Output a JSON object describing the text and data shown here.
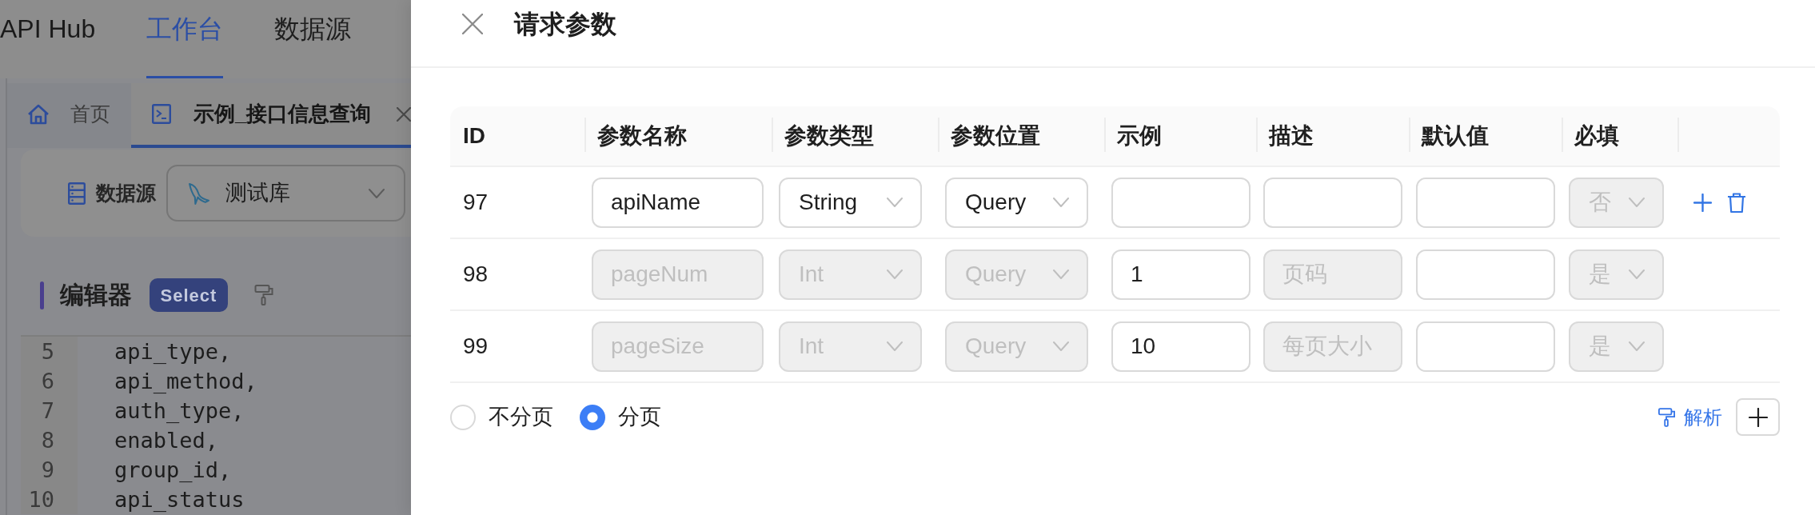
{
  "top_nav": {
    "brand": "API Hub",
    "items": [
      {
        "label": "工作台",
        "selected": true
      },
      {
        "label": "数据源",
        "selected": false
      }
    ]
  },
  "tabs": [
    {
      "kind": "home",
      "label": "首页",
      "selected": false,
      "closable": false
    },
    {
      "kind": "editor",
      "label": "示例_接口信息查询",
      "selected": true,
      "closable": true
    }
  ],
  "datasource": {
    "label": "数据源",
    "value": "测试库"
  },
  "editor": {
    "title": "编辑器",
    "statement_type": "Select",
    "lines": [
      {
        "number": "5",
        "code": "api_type,"
      },
      {
        "number": "6",
        "code": "api_method,"
      },
      {
        "number": "7",
        "code": "auth_type,"
      },
      {
        "number": "8",
        "code": "enabled,"
      },
      {
        "number": "9",
        "code": "group_id,"
      },
      {
        "number": "10",
        "code": "api_status"
      }
    ]
  },
  "drawer": {
    "title": "请求参数",
    "table": {
      "columns": [
        "ID",
        "参数名称",
        "参数类型",
        "参数位置",
        "示例",
        "描述",
        "默认值",
        "必填"
      ],
      "rows": [
        {
          "cells": [
            {
              "kind": "text",
              "value": "97"
            },
            {
              "kind": "input",
              "value": "apiName",
              "disabled": false
            },
            {
              "kind": "select",
              "value": "String",
              "disabled": false
            },
            {
              "kind": "select",
              "value": "Query",
              "disabled": false
            },
            {
              "kind": "input",
              "disabled": false
            },
            {
              "kind": "input",
              "disabled": false
            },
            {
              "kind": "input",
              "disabled": false
            },
            {
              "kind": "select",
              "value": "否",
              "disabled": true
            }
          ],
          "actions": true
        },
        {
          "cells": [
            {
              "kind": "text",
              "value": "98"
            },
            {
              "kind": "input",
              "value": "pageNum",
              "disabled": true
            },
            {
              "kind": "select",
              "value": "Int",
              "disabled": true
            },
            {
              "kind": "select",
              "value": "Query",
              "disabled": true
            },
            {
              "kind": "input",
              "value": "1",
              "disabled": false
            },
            {
              "kind": "input",
              "value": "页码",
              "disabled": true
            },
            {
              "kind": "input",
              "disabled": false
            },
            {
              "kind": "select",
              "value": "是",
              "disabled": true
            }
          ],
          "actions": false
        },
        {
          "cells": [
            {
              "kind": "text",
              "value": "99"
            },
            {
              "kind": "input",
              "value": "pageSize",
              "disabled": true
            },
            {
              "kind": "select",
              "value": "Int",
              "disabled": true
            },
            {
              "kind": "select",
              "value": "Query",
              "disabled": true
            },
            {
              "kind": "input",
              "value": "10",
              "disabled": false
            },
            {
              "kind": "input",
              "value": "每页大小",
              "disabled": true
            },
            {
              "kind": "input",
              "disabled": false
            },
            {
              "kind": "select",
              "value": "是",
              "disabled": true
            }
          ],
          "actions": false
        }
      ]
    },
    "pagination": [
      {
        "label": "不分页",
        "selected": false
      },
      {
        "label": "分页",
        "selected": true
      }
    ],
    "parse_link": "解析"
  }
}
